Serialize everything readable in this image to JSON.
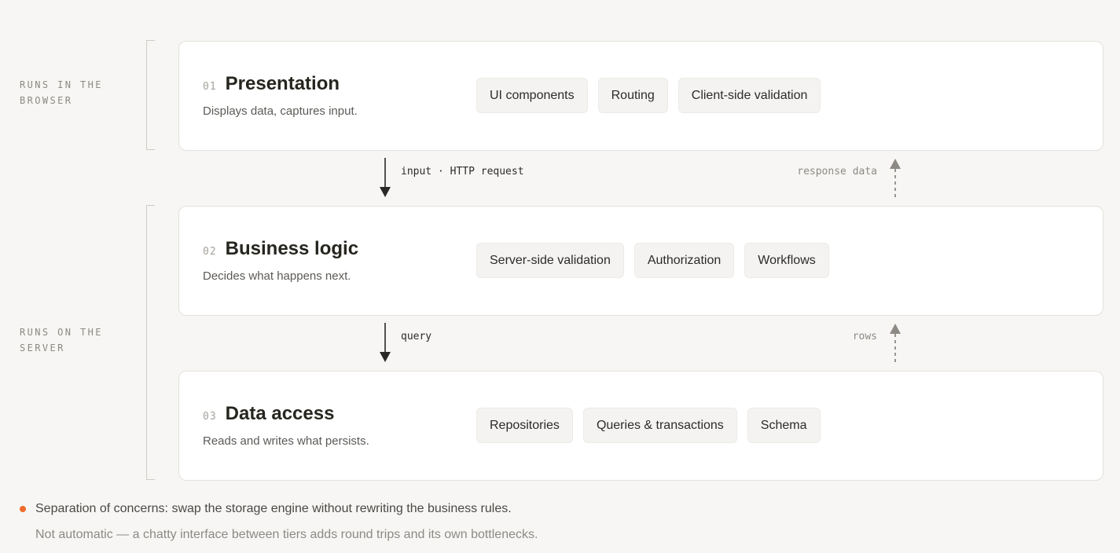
{
  "zones": [
    {
      "id": "browser",
      "label": "Runs in the browser"
    },
    {
      "id": "server",
      "label": "Runs on the server"
    }
  ],
  "tiers": [
    {
      "num": "01",
      "title": "Presentation",
      "desc": "Displays data, captures input.",
      "chips": [
        "UI components",
        "Routing",
        "Client-side validation"
      ]
    },
    {
      "num": "02",
      "title": "Business logic",
      "desc": "Decides what happens next.",
      "chips": [
        "Server-side validation",
        "Authorization",
        "Workflows"
      ]
    },
    {
      "num": "03",
      "title": "Data access",
      "desc": "Reads and writes what persists.",
      "chips": [
        "Repositories",
        "Queries & transactions",
        "Schema"
      ]
    }
  ],
  "flows": [
    {
      "down": "input · HTTP request",
      "up": "response data"
    },
    {
      "down": "query",
      "up": "rows"
    }
  ],
  "notes": {
    "main": "Separation of concerns: swap the storage engine without rewriting the business rules.",
    "sub": "Not automatic — a chatty interface between tiers adds round trips and its own bottlenecks.",
    "accent_color": "#ef6a2a"
  }
}
